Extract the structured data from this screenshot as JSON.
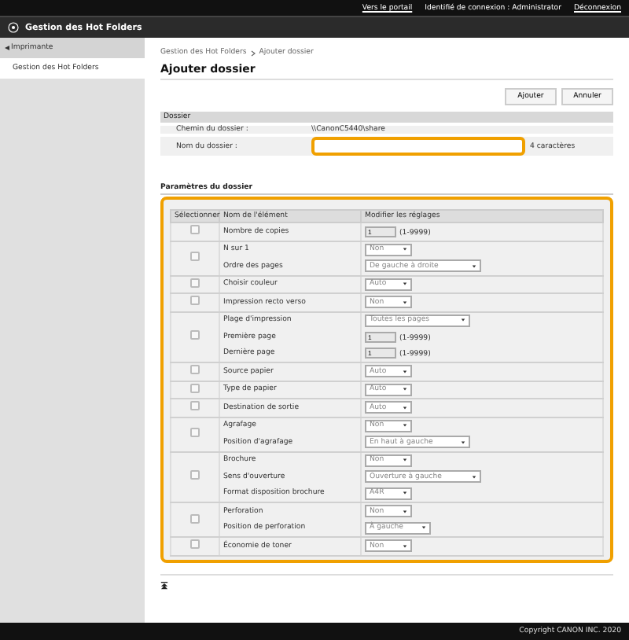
{
  "top_bar": {
    "links": [
      "Vers le portail",
      "Identifié de connexion : Administrator",
      "Déconnexion"
    ]
  },
  "header": {
    "title": "Gestion des Hot Folders"
  },
  "sidebar": {
    "back": "Imprimante",
    "items": [
      {
        "label": "Gestion des Hot Folders",
        "selected": true
      }
    ]
  },
  "breadcrumb": [
    "Gestion des Hot Folders",
    "Ajouter dossier"
  ],
  "page_title": "Ajouter dossier",
  "buttons": [
    "Ajouter",
    "Annuler"
  ],
  "folder": {
    "heading": "Dossier",
    "path_label": "Chemin du dossier :",
    "path_value": "\\\\CanonC5440\\share",
    "name_label": "Nom du dossier :",
    "name_hint": "4 caractères"
  },
  "settings": {
    "heading": "Paramètres du dossier",
    "columns": [
      "Sélectionner",
      "Nom de l'élément",
      "Modifier les réglages"
    ],
    "groups": [
      {
        "checked": false,
        "items": [
          {
            "name": "Nombre de copies",
            "kind": "number",
            "value": "1",
            "range": "(1-9999)"
          }
        ]
      },
      {
        "checked": false,
        "items": [
          {
            "name": "N sur 1",
            "kind": "select",
            "value": "Non"
          },
          {
            "name": "Ordre des pages",
            "kind": "select",
            "value": "De gauche à droite"
          }
        ]
      },
      {
        "checked": false,
        "items": [
          {
            "name": "Choisir couleur",
            "kind": "select",
            "value": "Auto"
          }
        ]
      },
      {
        "checked": false,
        "items": [
          {
            "name": "Impression recto verso",
            "kind": "select",
            "value": "Non"
          }
        ]
      },
      {
        "checked": false,
        "items": [
          {
            "name": "Plage d'impression",
            "kind": "select",
            "value": "Toutes les pages"
          },
          {
            "name": "Première page",
            "kind": "number",
            "value": "1",
            "range": "(1-9999)"
          },
          {
            "name": "Dernière page",
            "kind": "number",
            "value": "1",
            "range": "(1-9999)"
          }
        ]
      },
      {
        "checked": false,
        "items": [
          {
            "name": "Source papier",
            "kind": "select",
            "value": "Auto"
          }
        ]
      },
      {
        "checked": false,
        "items": [
          {
            "name": "Type de papier",
            "kind": "select",
            "value": "Auto"
          }
        ]
      },
      {
        "checked": false,
        "items": [
          {
            "name": "Destination de sortie",
            "kind": "select",
            "value": "Auto"
          }
        ]
      },
      {
        "checked": false,
        "items": [
          {
            "name": "Agrafage",
            "kind": "select",
            "value": "Non"
          },
          {
            "name": "Position d'agrafage",
            "kind": "select",
            "value": "En haut à gauche"
          }
        ]
      },
      {
        "checked": false,
        "items": [
          {
            "name": "Brochure",
            "kind": "select",
            "value": "Non"
          },
          {
            "name": "Sens d'ouverture",
            "kind": "select",
            "value": "Ouverture à gauche"
          },
          {
            "name": "Format disposition brochure",
            "kind": "select",
            "value": "A4R"
          }
        ]
      },
      {
        "checked": false,
        "items": [
          {
            "name": "Perforation",
            "kind": "select",
            "value": "Non"
          },
          {
            "name": "Position de perforation",
            "kind": "select",
            "value": "À gauche"
          }
        ]
      },
      {
        "checked": false,
        "items": [
          {
            "name": "Économie de toner",
            "kind": "select",
            "value": "Non"
          }
        ]
      }
    ]
  },
  "footer": {
    "copyright": "Copyright CANON INC. 2020"
  }
}
